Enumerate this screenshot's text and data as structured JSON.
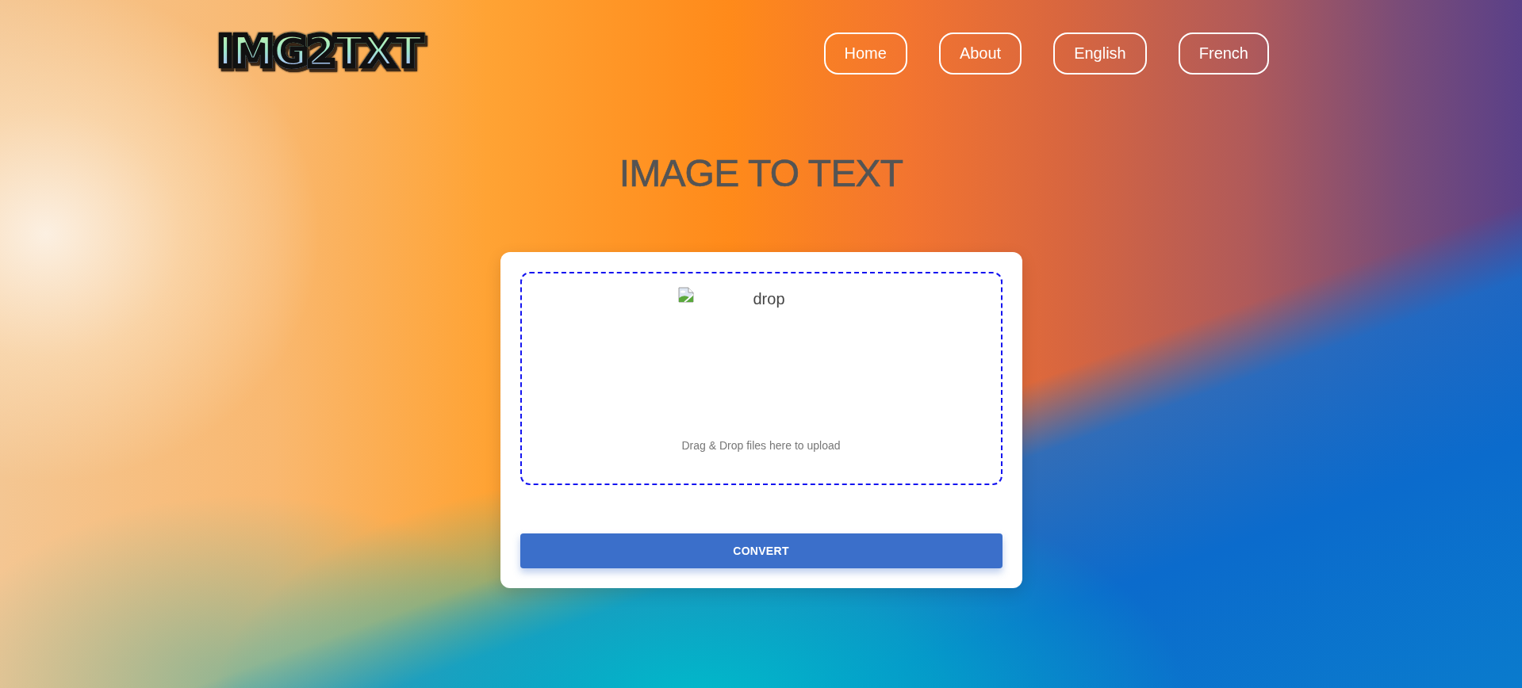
{
  "header": {
    "logo": "IMG2TXT",
    "nav": [
      {
        "label": "Home"
      },
      {
        "label": "About"
      },
      {
        "label": "English"
      },
      {
        "label": "French"
      }
    ]
  },
  "title": "IMAGE TO TEXT",
  "upload_card": {
    "dropzone": {
      "image_alt": "drop",
      "hint": "Drag & Drop files here to upload"
    },
    "button": "CONVERT"
  }
}
